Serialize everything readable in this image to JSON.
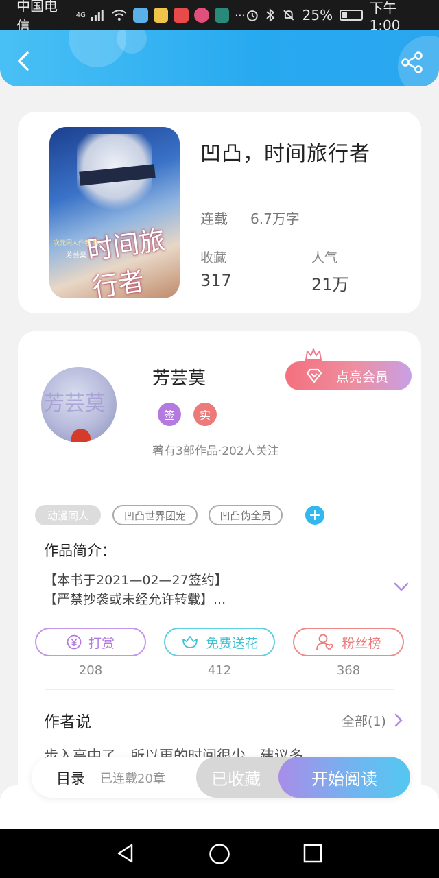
{
  "status_bar": {
    "carrier": "中国电信",
    "network": "4G",
    "battery": "25%",
    "time": "下午1:00",
    "icons": [
      "signal-icon",
      "wifi-icon",
      "app-icon",
      "alarm-icon",
      "bluetooth-icon",
      "mute-icon",
      "battery-icon"
    ]
  },
  "header": {
    "back_icon": "back-icon",
    "share_icon": "share-icon"
  },
  "book": {
    "title": "凹凸，时间旅行者",
    "status": "连载",
    "word_count": "6.7万字",
    "collect_label": "收藏",
    "collect_value": "317",
    "popularity_label": "人气",
    "popularity_value": "21万",
    "cover": {
      "title": "时间旅行者",
      "small_text": "次元同人作者 新人",
      "author": "芳芸莫"
    }
  },
  "author": {
    "name": "芳芸莫",
    "badge_sign": "签",
    "badge_real": "实",
    "info": "著有3部作品·202人关注",
    "avatar_text": "芳芸莫",
    "vip_button": "点亮会员"
  },
  "tags": [
    "动漫同人",
    "凹凸世界团宠",
    "凹凸伪全员"
  ],
  "intro": {
    "title": "作品简介：",
    "line1": "【本书于2021—02—27签约】",
    "line2": "【严禁抄袭或未经允许转载】..."
  },
  "actions": [
    {
      "label": "打赏",
      "count": "208",
      "icon": "yuan-icon"
    },
    {
      "label": "免费送花",
      "count": "412",
      "icon": "flower-icon"
    },
    {
      "label": "粉丝榜",
      "count": "368",
      "icon": "fans-icon"
    }
  ],
  "author_say": {
    "title": "作者说",
    "all": "全部(1)",
    "preview": "步入高中了，所以更的时间很少，建议多..."
  },
  "bottom_bar": {
    "toc": "目录",
    "toc_sub": "已连载20章",
    "favorited": "已收藏",
    "start_read": "开始阅读"
  },
  "colors": {
    "header_blue": "#2aa6ef",
    "vip_pink": "#f4707e",
    "purple": "#b57ae0",
    "teal": "#3cc4d6",
    "coral": "#ec7a7a"
  }
}
